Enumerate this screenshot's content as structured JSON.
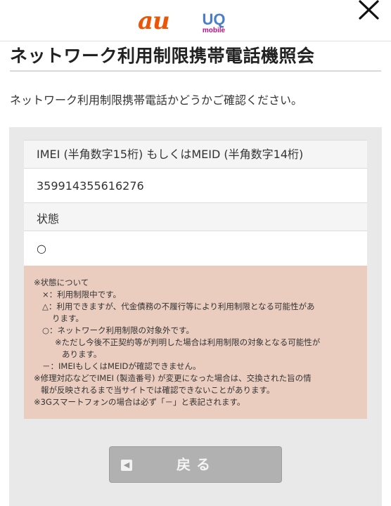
{
  "header": {
    "logo_au": "au",
    "logo_uq": "UQ",
    "logo_uq_sub": "mobile",
    "close_icon": "close-icon"
  },
  "page": {
    "title": "ネットワーク利用制限携帯電話機照会",
    "intro": "ネットワーク利用制限携帯電話かどうかご確認ください。"
  },
  "form": {
    "imei_label": "IMEI (半角数字15桁) もしくはMEID (半角数字14桁)",
    "imei_value": "359914355616276",
    "status_label": "状態",
    "status_value": "○"
  },
  "notes": {
    "lines": [
      "※状態について",
      "×：利用制限中です。",
      "△：利用できますが、代金債務の不履行等により利用制限となる可能性があ",
      "ります。",
      "○：ネットワーク利用制限の対象外です。",
      "※ただし今後不正契約等が判明した場合は利用制限の対象となる可能性が",
      "あります。",
      "－：IMEIもしくはMEIDが確認できません。",
      "※修理対応などでIMEI (製造番号) が変更になった場合は、交換された旨の情",
      "報が反映されるまで当サイトでは確認できないことがあります。",
      "※3Gスマートフォンの場合は必ず「－」と表記されます。"
    ]
  },
  "actions": {
    "back_label": "戻る",
    "back_icon": "chevron-left-icon"
  },
  "colors": {
    "au_brand": "#eb5505",
    "uq_brand": "#4a7fc8",
    "uq_mobile": "#c40d83",
    "notes_bg": "#ebcdc0",
    "panel_bg": "#e9e9e9",
    "button_bg": "#b1b1b1"
  }
}
